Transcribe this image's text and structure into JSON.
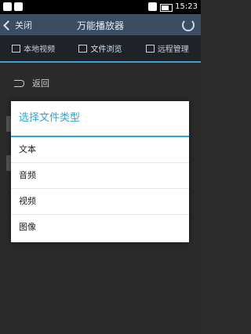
{
  "status_bar": {
    "time": "15:23",
    "icons": [
      "notification-icon",
      "wifi-icon",
      "battery-icon"
    ]
  },
  "title_bar": {
    "back_label": "关闭",
    "title": "万能播放器",
    "refresh_icon": "refresh-icon"
  },
  "tabs": [
    {
      "label": "本地视频",
      "icon": "film-icon"
    },
    {
      "label": "文件浏览",
      "icon": "folder-icon"
    },
    {
      "label": "远程管理",
      "icon": "remote-icon"
    }
  ],
  "content": {
    "return_label": "返回"
  },
  "dialog": {
    "title": "选择文件类型",
    "options": [
      "文本",
      "音频",
      "视频",
      "图像"
    ]
  },
  "colors": {
    "accent": "#2aa6db",
    "title_bar": "#3a4d61",
    "tab_bar": "#1f2327",
    "background": "#2b2b2b"
  }
}
